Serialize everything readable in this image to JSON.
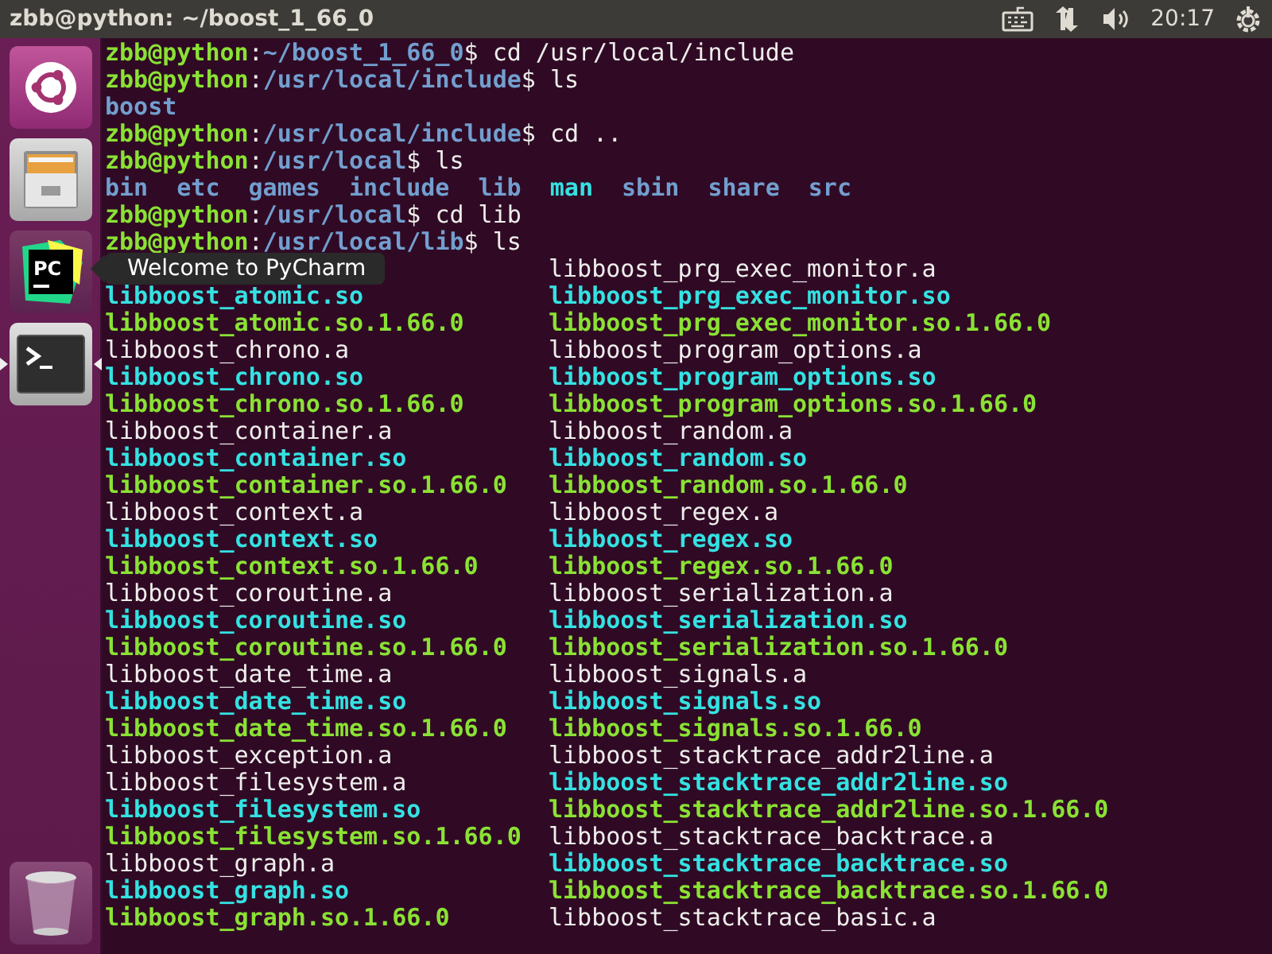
{
  "top_bar": {
    "title": "zbb@python: ~/boost_1_66_0",
    "clock": "20:17"
  },
  "launcher": {
    "items": [
      {
        "kind": "ubuntu",
        "focused": false
      },
      {
        "kind": "files",
        "focused": false
      },
      {
        "kind": "pycharm",
        "focused": false,
        "icon_text": "PC"
      },
      {
        "kind": "terminal",
        "focused": true
      },
      {
        "kind": "trash",
        "focused": false
      }
    ],
    "tooltip": {
      "text": "Welcome to PyCharm"
    }
  },
  "terminal": {
    "lines": [
      {
        "kind": "prompt",
        "segments": [
          {
            "text": "zbb@python",
            "kind": "user"
          },
          {
            "text": ":",
            "kind": "plain"
          },
          {
            "text": "~/boost_1_66_0",
            "kind": "path"
          },
          {
            "text": "$ cd /usr/local/include",
            "kind": "plain"
          }
        ]
      },
      {
        "kind": "prompt",
        "segments": [
          {
            "text": "zbb@python",
            "kind": "user"
          },
          {
            "text": ":",
            "kind": "plain"
          },
          {
            "text": "/usr/local/include",
            "kind": "path"
          },
          {
            "text": "$ ls",
            "kind": "plain"
          }
        ]
      },
      {
        "kind": "output",
        "segments": [
          {
            "text": "boost",
            "kind": "dir"
          }
        ]
      },
      {
        "kind": "prompt",
        "segments": [
          {
            "text": "zbb@python",
            "kind": "user"
          },
          {
            "text": ":",
            "kind": "plain"
          },
          {
            "text": "/usr/local/include",
            "kind": "path"
          },
          {
            "text": "$ cd ..",
            "kind": "plain"
          }
        ]
      },
      {
        "kind": "prompt",
        "segments": [
          {
            "text": "zbb@python",
            "kind": "user"
          },
          {
            "text": ":",
            "kind": "plain"
          },
          {
            "text": "/usr/local",
            "kind": "path"
          },
          {
            "text": "$ ls",
            "kind": "plain"
          }
        ]
      },
      {
        "kind": "output",
        "segments": [
          {
            "text": "bin",
            "kind": "dir"
          },
          {
            "text": "etc",
            "kind": "dir"
          },
          {
            "text": "games",
            "kind": "dir"
          },
          {
            "text": "include",
            "kind": "dir"
          },
          {
            "text": "lib",
            "kind": "dir"
          },
          {
            "text": "man",
            "kind": "link"
          },
          {
            "text": "sbin",
            "kind": "dir"
          },
          {
            "text": "share",
            "kind": "dir"
          },
          {
            "text": "src",
            "kind": "dir"
          }
        ]
      },
      {
        "kind": "prompt",
        "segments": [
          {
            "text": "zbb@python",
            "kind": "user"
          },
          {
            "text": ":",
            "kind": "plain"
          },
          {
            "text": "/usr/local",
            "kind": "path"
          },
          {
            "text": "$ cd lib",
            "kind": "plain"
          }
        ]
      },
      {
        "kind": "prompt",
        "segments": [
          {
            "text": "zbb@python",
            "kind": "user"
          },
          {
            "text": ":",
            "kind": "plain"
          },
          {
            "text": "/usr/local/lib",
            "kind": "path"
          },
          {
            "text": "$ ls",
            "kind": "plain"
          }
        ]
      }
    ],
    "listing": {
      "columns": [
        [
          {
            "text": "libboost_atomic.so",
            "kind": "link"
          },
          {
            "text": "libboost_atomic.so.1.66.0",
            "kind": "exec"
          },
          {
            "text": "libboost_chrono.a",
            "kind": "file"
          },
          {
            "text": "libboost_chrono.so",
            "kind": "link"
          },
          {
            "text": "libboost_chrono.so.1.66.0",
            "kind": "exec"
          },
          {
            "text": "libboost_container.a",
            "kind": "file"
          },
          {
            "text": "libboost_container.so",
            "kind": "link"
          },
          {
            "text": "libboost_container.so.1.66.0",
            "kind": "exec"
          },
          {
            "text": "libboost_context.a",
            "kind": "file"
          },
          {
            "text": "libboost_context.so",
            "kind": "link"
          },
          {
            "text": "libboost_context.so.1.66.0",
            "kind": "exec"
          },
          {
            "text": "libboost_coroutine.a",
            "kind": "file"
          },
          {
            "text": "libboost_coroutine.so",
            "kind": "link"
          },
          {
            "text": "libboost_coroutine.so.1.66.0",
            "kind": "exec"
          },
          {
            "text": "libboost_date_time.a",
            "kind": "file"
          },
          {
            "text": "libboost_date_time.so",
            "kind": "link"
          },
          {
            "text": "libboost_date_time.so.1.66.0",
            "kind": "exec"
          },
          {
            "text": "libboost_exception.a",
            "kind": "file"
          },
          {
            "text": "libboost_filesystem.a",
            "kind": "file"
          },
          {
            "text": "libboost_filesystem.so",
            "kind": "link"
          },
          {
            "text": "libboost_filesystem.so.1.66.0",
            "kind": "exec"
          },
          {
            "text": "libboost_graph.a",
            "kind": "file"
          },
          {
            "text": "libboost_graph.so",
            "kind": "link"
          },
          {
            "text": "libboost_graph.so.1.66.0",
            "kind": "exec"
          }
        ],
        [
          {
            "text": "libboost_prg_exec_monitor.a",
            "kind": "file"
          },
          {
            "text": "libboost_prg_exec_monitor.so",
            "kind": "link"
          },
          {
            "text": "libboost_prg_exec_monitor.so.1.66.0",
            "kind": "exec"
          },
          {
            "text": "libboost_program_options.a",
            "kind": "file"
          },
          {
            "text": "libboost_program_options.so",
            "kind": "link"
          },
          {
            "text": "libboost_program_options.so.1.66.0",
            "kind": "exec"
          },
          {
            "text": "libboost_random.a",
            "kind": "file"
          },
          {
            "text": "libboost_random.so",
            "kind": "link"
          },
          {
            "text": "libboost_random.so.1.66.0",
            "kind": "exec"
          },
          {
            "text": "libboost_regex.a",
            "kind": "file"
          },
          {
            "text": "libboost_regex.so",
            "kind": "link"
          },
          {
            "text": "libboost_regex.so.1.66.0",
            "kind": "exec"
          },
          {
            "text": "libboost_serialization.a",
            "kind": "file"
          },
          {
            "text": "libboost_serialization.so",
            "kind": "link"
          },
          {
            "text": "libboost_serialization.so.1.66.0",
            "kind": "exec"
          },
          {
            "text": "libboost_signals.a",
            "kind": "file"
          },
          {
            "text": "libboost_signals.so",
            "kind": "link"
          },
          {
            "text": "libboost_signals.so.1.66.0",
            "kind": "exec"
          },
          {
            "text": "libboost_stacktrace_addr2line.a",
            "kind": "file"
          },
          {
            "text": "libboost_stacktrace_addr2line.so",
            "kind": "link"
          },
          {
            "text": "libboost_stacktrace_addr2line.so.1.66.0",
            "kind": "exec"
          },
          {
            "text": "libboost_stacktrace_backtrace.a",
            "kind": "file"
          },
          {
            "text": "libboost_stacktrace_backtrace.so",
            "kind": "link"
          },
          {
            "text": "libboost_stacktrace_backtrace.so.1.66.0",
            "kind": "exec"
          },
          {
            "text": "libboost_stacktrace_basic.a",
            "kind": "file"
          }
        ]
      ]
    }
  }
}
